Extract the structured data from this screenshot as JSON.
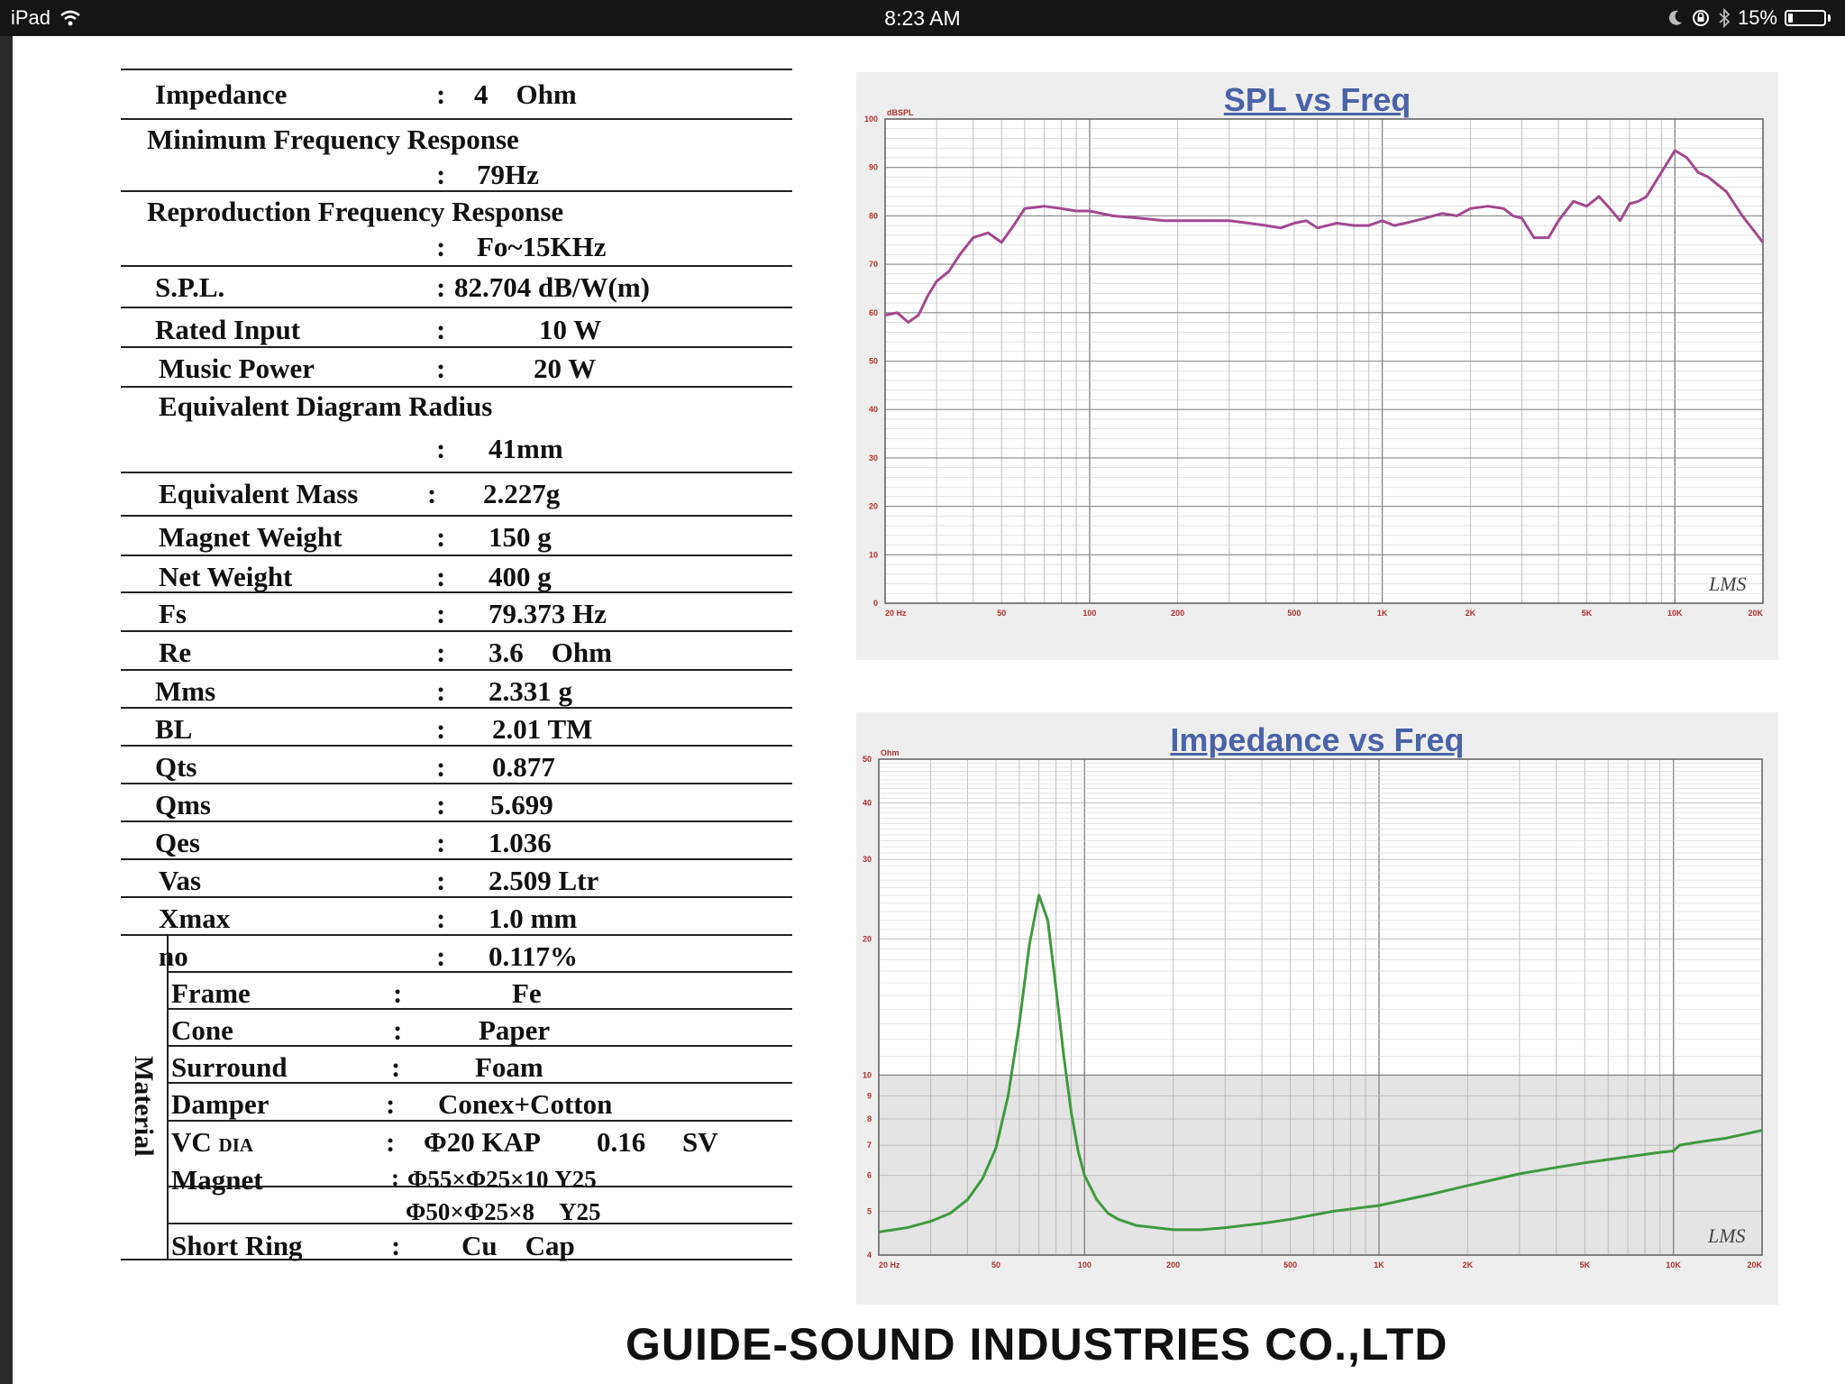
{
  "status_bar": {
    "device": "iPad",
    "time": "8:23 AM",
    "battery": "15%"
  },
  "specs": [
    {
      "label": "Impedance",
      "colon": ":",
      "value": "4    Ohm"
    },
    {
      "label": "Minimum Frequency Response",
      "colon": ":",
      "value": "79Hz"
    },
    {
      "label": "Reproduction Frequency Response",
      "colon": ":",
      "value": "Fo~15KHz"
    },
    {
      "label": "S.P.L.",
      "colon": ":",
      "value": "82.704 dB/W(m)"
    },
    {
      "label": "Rated Input",
      "colon": ":",
      "value": "10 W"
    },
    {
      "label": "Music Power",
      "colon": ":",
      "value": "20 W"
    },
    {
      "label": "Equivalent Diagram Radius",
      "colon": ":",
      "value": "41mm"
    },
    {
      "label": "Equivalent Mass",
      "colon": ":",
      "value": "2.227g"
    },
    {
      "label": "Magnet Weight",
      "colon": ":",
      "value": "150 g"
    },
    {
      "label": "Net Weight",
      "colon": ":",
      "value": "400 g"
    },
    {
      "label": "Fs",
      "colon": ":",
      "value": "79.373 Hz"
    },
    {
      "label": "Re",
      "colon": ":",
      "value": "3.6    Ohm"
    },
    {
      "label": "Mms",
      "colon": ":",
      "value": "2.331 g"
    },
    {
      "label": "BL",
      "colon": ":",
      "value": "2.01 TM"
    },
    {
      "label": "Qts",
      "colon": ":",
      "value": "0.877"
    },
    {
      "label": "Qms",
      "colon": ":",
      "value": "5.699"
    },
    {
      "label": "Qes",
      "colon": ":",
      "value": "1.036"
    },
    {
      "label": "Vas",
      "colon": ":",
      "value": "2.509 Ltr"
    },
    {
      "label": "Xmax",
      "colon": ":",
      "value": "1.0 mm"
    },
    {
      "label": "no",
      "colon": ":",
      "value": "0.117%"
    }
  ],
  "material": {
    "heading": "Material",
    "rows": [
      {
        "label": "Frame",
        "colon": ":",
        "value": "Fe"
      },
      {
        "label": "Cone",
        "colon": ":",
        "value": "Paper"
      },
      {
        "label": "Surround",
        "colon": ":",
        "value": "Foam"
      },
      {
        "label": "Damper",
        "colon": ":",
        "value": "Conex+Cotton"
      },
      {
        "label": "VC",
        "sublabel": "DIA",
        "colon": ":",
        "value": "Φ20 KAP",
        "value2": "0.16",
        "value3": "SV"
      },
      {
        "label": "Magnet",
        "colon": ":",
        "value": "Φ55×Φ25×10 Y25",
        "value2": "Φ50×Φ25×8    Y25"
      },
      {
        "label": "Short Ring",
        "colon": ":",
        "value": "Cu    Cap"
      }
    ]
  },
  "company": "GUIDE-SOUND INDUSTRIES CO.,LTD",
  "colors": {
    "spl_line": "#a3488f",
    "impedance_line": "#3e9a3e",
    "chart_title": "#4a63a8",
    "tick_label": "#b03030"
  },
  "chart_data": [
    {
      "type": "line",
      "title": "SPL vs Freq",
      "ylabel": "dBSPL",
      "log_x": true,
      "xlim": [
        20,
        20000
      ],
      "ylim": [
        0,
        100
      ],
      "grid": true,
      "x_tick_labels": [
        "20 Hz",
        "50",
        "100",
        "200",
        "500",
        "1K",
        "2K",
        "5K",
        "10K",
        "20K"
      ],
      "x_tick_values": [
        20,
        50,
        100,
        200,
        500,
        1000,
        2000,
        5000,
        10000,
        20000
      ],
      "y_tick_labels": [
        "0",
        "10",
        "20",
        "30",
        "40",
        "50",
        "60",
        "70",
        "80",
        "90",
        "100"
      ],
      "y_tick_values": [
        0,
        10,
        20,
        30,
        40,
        50,
        60,
        70,
        80,
        90,
        100
      ],
      "watermark": "LMS",
      "series": [
        {
          "x": [
            20,
            22,
            24,
            26,
            28,
            30,
            33,
            36,
            40,
            45,
            50,
            55,
            60,
            70,
            80,
            90,
            100,
            120,
            150,
            180,
            200,
            250,
            300,
            350,
            400,
            450,
            500,
            550,
            600,
            700,
            800,
            900,
            1000,
            1100,
            1200,
            1400,
            1600,
            1800,
            2000,
            2300,
            2600,
            2800,
            3000,
            3300,
            3700,
            4000,
            4500,
            5000,
            5500,
            6000,
            6500,
            7000,
            7500,
            8000,
            9000,
            10000,
            11000,
            12000,
            13000,
            15000,
            17000,
            20000
          ],
          "y": [
            59.5,
            60,
            58,
            59.5,
            63.5,
            66.5,
            68.5,
            72,
            75.5,
            76.5,
            74.5,
            78,
            81.5,
            82,
            81.5,
            81,
            81,
            80,
            79.5,
            79,
            79,
            79,
            79,
            78.5,
            78,
            77.5,
            78.5,
            79,
            77.5,
            78.5,
            78,
            78,
            79,
            78,
            78.5,
            79.5,
            80.5,
            80,
            81.5,
            82,
            81.5,
            80,
            79.5,
            75.5,
            75.5,
            79,
            83,
            82,
            84,
            81.5,
            79,
            82.5,
            83,
            84,
            89,
            93.5,
            92,
            89,
            88,
            85,
            80,
            74.5
          ]
        }
      ]
    },
    {
      "type": "line",
      "title": "Impedance vs Freq",
      "ylabel": "Ohm",
      "log_x": true,
      "log_y": true,
      "xlim": [
        20,
        20000
      ],
      "ylim": [
        4,
        50
      ],
      "grid": true,
      "x_tick_labels": [
        "20 Hz",
        "50",
        "100",
        "200",
        "500",
        "1K",
        "2K",
        "5K",
        "10K",
        "20K"
      ],
      "x_tick_values": [
        20,
        50,
        100,
        200,
        500,
        1000,
        2000,
        5000,
        10000,
        20000
      ],
      "y_tick_labels": [
        "4",
        "5",
        "6",
        "7",
        "8",
        "9",
        "10",
        "20",
        "30",
        "40",
        "50"
      ],
      "y_tick_values": [
        4,
        5,
        6,
        7,
        8,
        9,
        10,
        20,
        30,
        40,
        50
      ],
      "watermark": "LMS",
      "series": [
        {
          "x": [
            20,
            25,
            30,
            35,
            40,
            45,
            50,
            55,
            60,
            65,
            70,
            75,
            80,
            85,
            90,
            95,
            100,
            110,
            120,
            130,
            150,
            200,
            250,
            300,
            400,
            500,
            700,
            1000,
            1500,
            2000,
            3000,
            4000,
            5000,
            7000,
            9000,
            10000,
            10500,
            12000,
            15000,
            20000
          ],
          "y": [
            4.5,
            4.6,
            4.75,
            4.95,
            5.3,
            5.9,
            6.9,
            9.0,
            13.0,
            19.5,
            25.0,
            22.0,
            15.5,
            11.0,
            8.3,
            6.8,
            6.0,
            5.3,
            4.95,
            4.8,
            4.65,
            4.55,
            4.55,
            4.6,
            4.7,
            4.8,
            5.0,
            5.15,
            5.45,
            5.7,
            6.05,
            6.25,
            6.4,
            6.6,
            6.75,
            6.8,
            7.0,
            7.1,
            7.25,
            7.55
          ]
        }
      ]
    }
  ]
}
